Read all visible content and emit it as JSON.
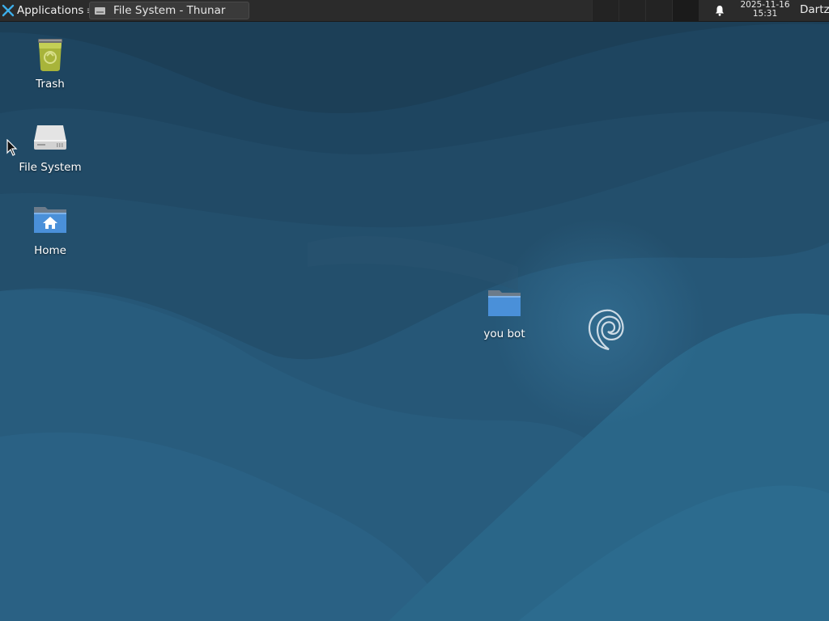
{
  "panel": {
    "apps_label": "Applications",
    "apps_suffix": "≡",
    "task_title": "File System - Thunar",
    "clock_date": "2025-11-16",
    "clock_time": "15:31",
    "user": "Dartz"
  },
  "desktop": {
    "icons": [
      {
        "label": "Trash",
        "icon": "trash-icon"
      },
      {
        "label": "File System",
        "icon": "drive-icon"
      },
      {
        "label": "Home",
        "icon": "home-folder-icon"
      },
      {
        "label": "you bot",
        "icon": "folder-icon"
      }
    ]
  },
  "colors": {
    "panel_bg": "#2b2b2b",
    "wallpaper_base": "#1f4a66",
    "accent": "#4a90d9"
  }
}
